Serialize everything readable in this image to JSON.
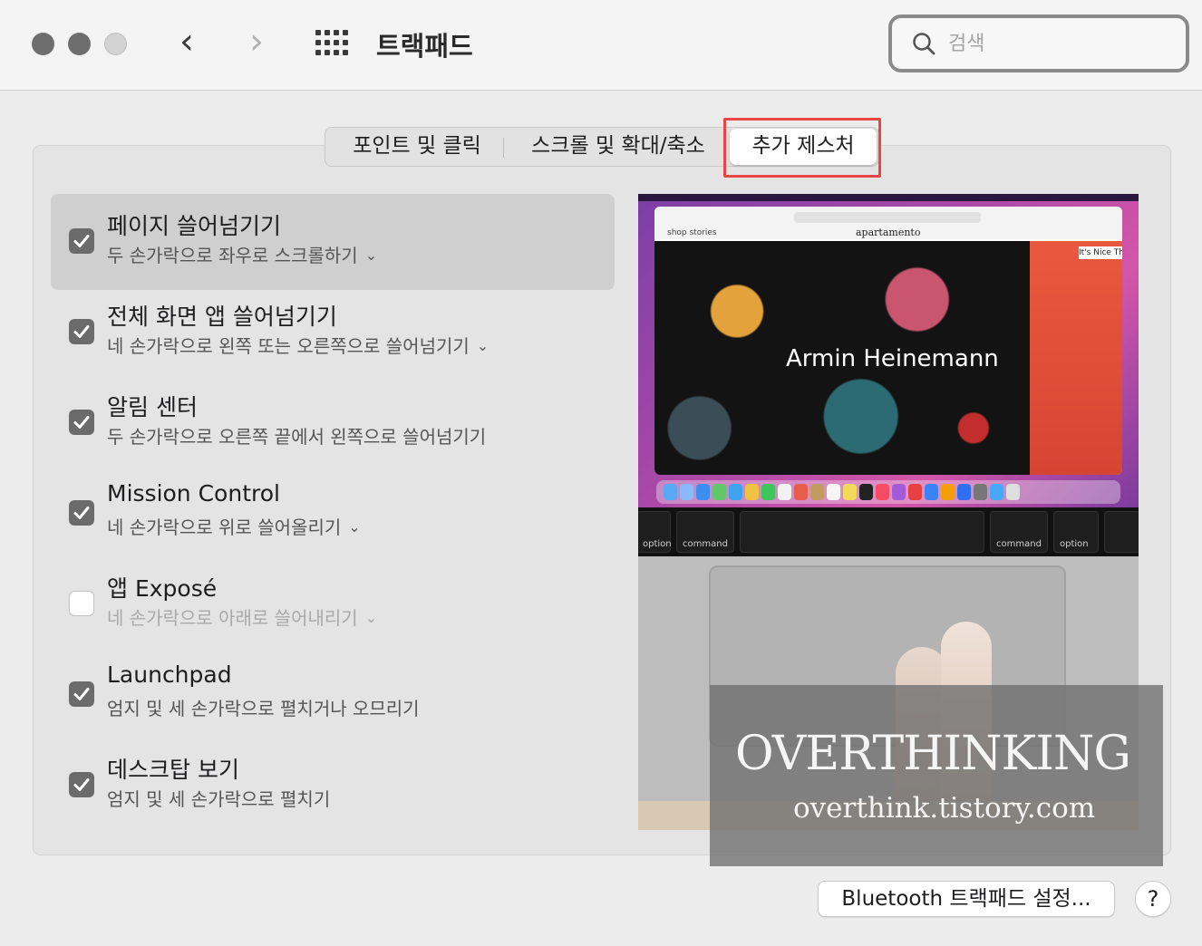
{
  "window": {
    "title": "트랙패드"
  },
  "search": {
    "placeholder": "검색"
  },
  "tabs": [
    {
      "label": "포인트 및 클릭"
    },
    {
      "label": "스크롤 및 확대/축소"
    },
    {
      "label": "추가 제스처",
      "selected": true
    }
  ],
  "gestures": [
    {
      "title": "페이지 쓸어넘기기",
      "subtitle": "두 손가락으로 좌우로 스크롤하기",
      "checked": true,
      "has_dropdown": true,
      "selected": true
    },
    {
      "title": "전체 화면 앱 쓸어넘기기",
      "subtitle": "네 손가락으로 왼쪽 또는 오른쪽으로 쓸어넘기기",
      "checked": true,
      "has_dropdown": true
    },
    {
      "title": "알림 센터",
      "subtitle": "두 손가락으로 오른쪽 끝에서 왼쪽으로 쓸어넘기기",
      "checked": true,
      "has_dropdown": false
    },
    {
      "title": "Mission Control",
      "subtitle": "네 손가락으로 위로 쓸어올리기",
      "checked": true,
      "has_dropdown": true
    },
    {
      "title": "앱 Exposé",
      "subtitle": "네 손가락으로 아래로 쓸어내리기",
      "checked": false,
      "has_dropdown": true
    },
    {
      "title": "Launchpad",
      "subtitle": "엄지 및 세 손가락으로 펼치거나 오므리기",
      "checked": true,
      "has_dropdown": false
    },
    {
      "title": "데스크탑 보기",
      "subtitle": "엄지 및 세 손가락으로 펼치기",
      "checked": true,
      "has_dropdown": false
    }
  ],
  "preview": {
    "site_brand": "apartamento",
    "site_nav": "shop     stories",
    "hero_name": "Armin Heinemann",
    "side_title": "It's Nice Tha",
    "keys": [
      "option",
      "command",
      "command",
      "option"
    ]
  },
  "watermark": {
    "line1": "OVERTHINKING",
    "line2": "overthink.tistory.com"
  },
  "footer": {
    "bluetooth_button": "Bluetooth 트랙패드 설정...",
    "help": "?"
  },
  "colors": {
    "checkbox_on": "#6b6b6b",
    "highlight": "#e84545",
    "selected_row": "#cfcfcf"
  }
}
